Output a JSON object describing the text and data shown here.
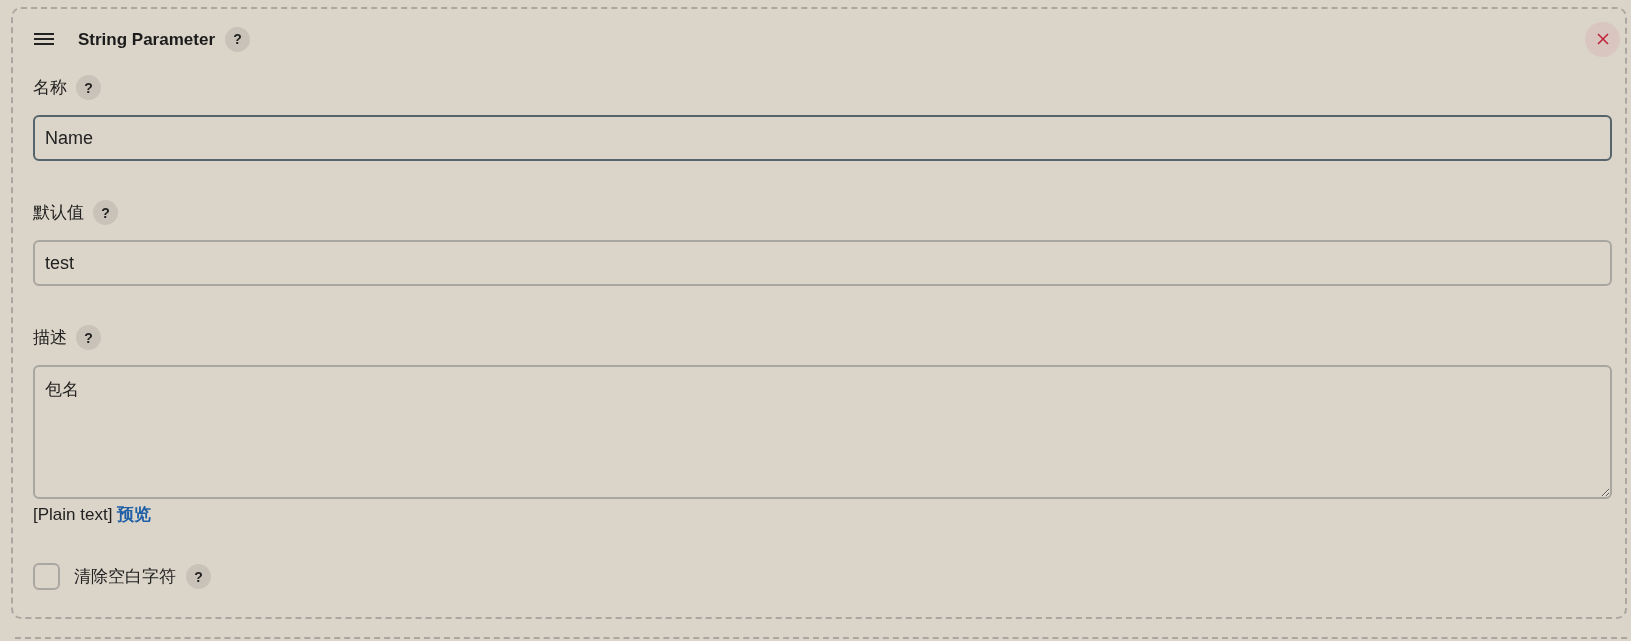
{
  "header": {
    "title": "String Parameter",
    "help": "?"
  },
  "fields": [
    {
      "kind": "input",
      "label": "名称",
      "help": "?",
      "value": "Name",
      "focused": true
    },
    {
      "kind": "input",
      "label": "默认值",
      "help": "?",
      "value": "test",
      "focused": false
    },
    {
      "kind": "textarea",
      "label": "描述",
      "help": "?",
      "value": "包名",
      "focused": false
    }
  ],
  "description_footer": {
    "format": "[Plain text]",
    "preview_link": "预览"
  },
  "checkbox": {
    "label": "清除空白字符",
    "help": "?",
    "checked": false
  }
}
